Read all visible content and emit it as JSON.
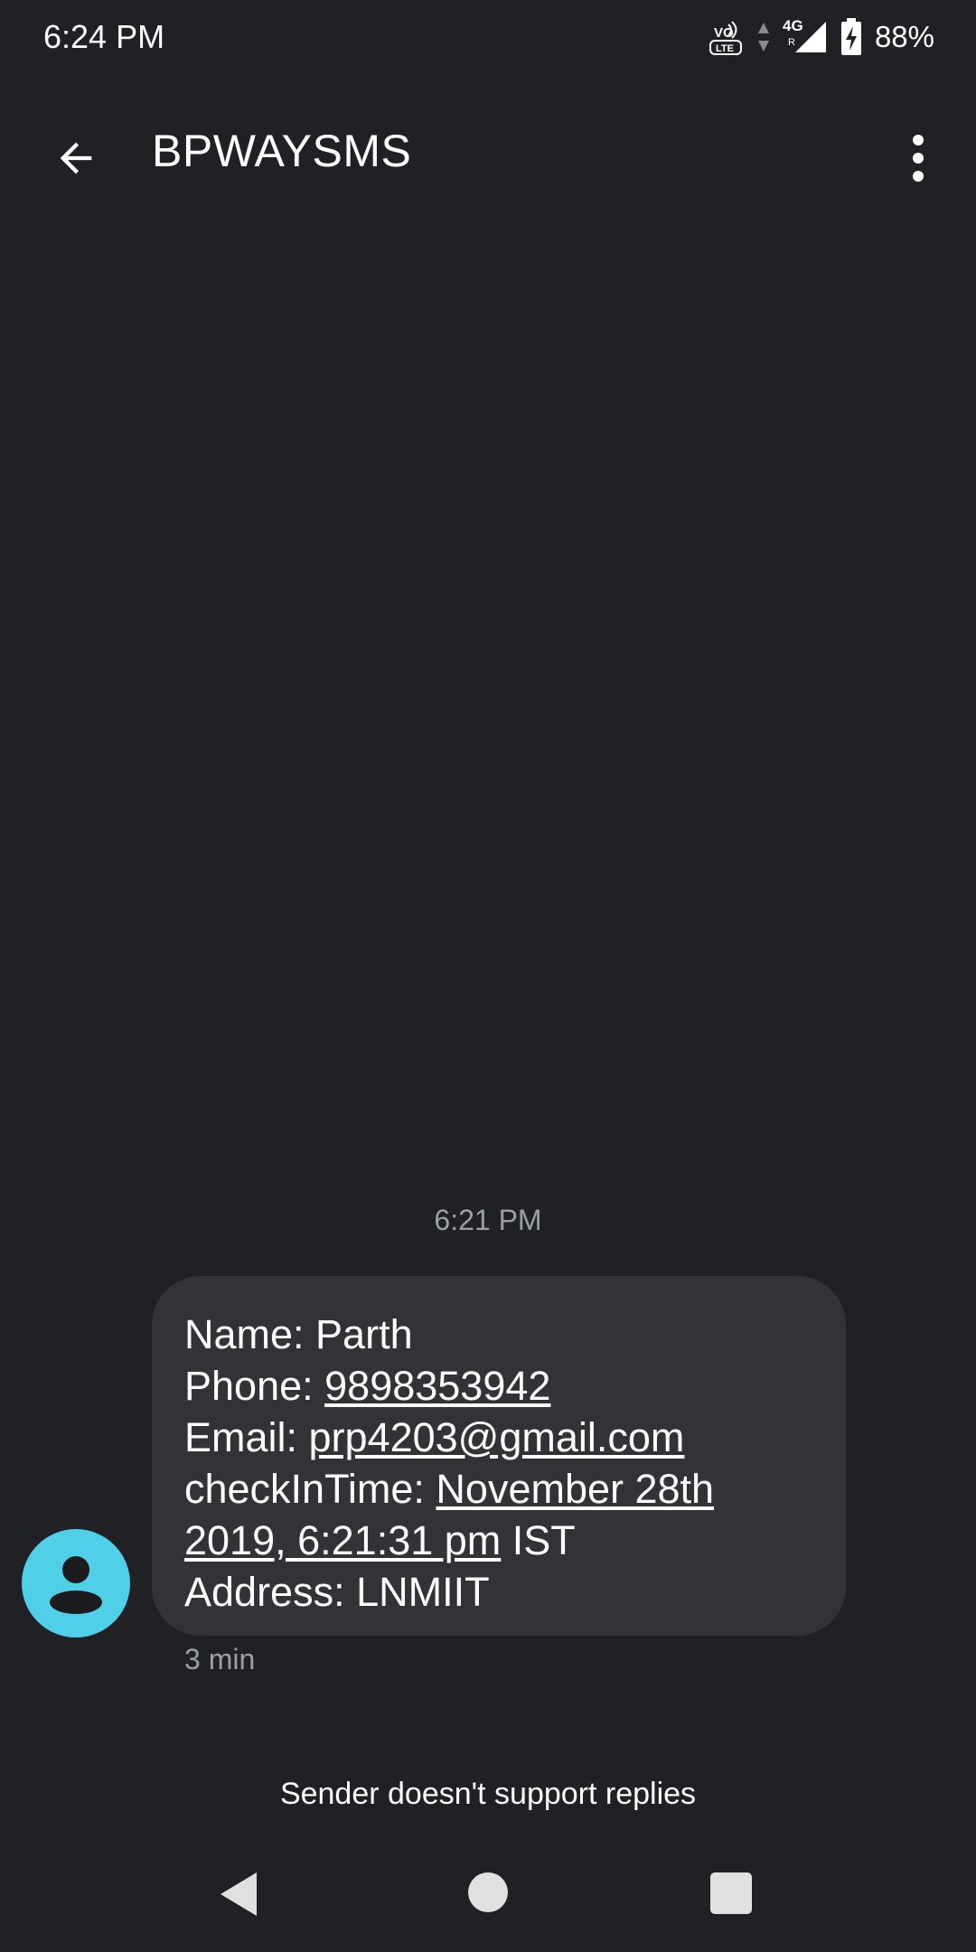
{
  "status_bar": {
    "time": "6:24 PM",
    "volte_label_top": "VO",
    "volte_label_bottom": "LTE",
    "network_label": "4G",
    "roaming_label": "R",
    "battery_percent": "88%",
    "icons": [
      "volte-icon",
      "data-activity-icon",
      "signal-icon",
      "battery-charging-icon"
    ]
  },
  "app_bar": {
    "title": "BPWAYSMS",
    "back_icon": "arrow-back-icon",
    "menu_icon": "more-vert-icon"
  },
  "conversation": {
    "timestamp": "6:21 PM",
    "message": {
      "name_label": "Name: ",
      "name_value": "Parth",
      "phone_label": "Phone: ",
      "phone_value": "9898353942",
      "email_label": "Email: ",
      "email_value": "prp4203@gmail.com",
      "checkin_label": "checkInTime: ",
      "checkin_value_line1": "November 28th",
      "checkin_value_line2": "2019, 6:21:31 pm",
      "checkin_suffix": " IST",
      "address_label": "Address: ",
      "address_value": "LNMIIT"
    },
    "age": "3 min",
    "avatar_color": "#4fcfe8"
  },
  "footer": {
    "notice": "Sender doesn't support replies"
  },
  "nav_bar": {
    "icons": [
      "nav-back-icon",
      "nav-home-icon",
      "nav-recents-icon"
    ]
  }
}
